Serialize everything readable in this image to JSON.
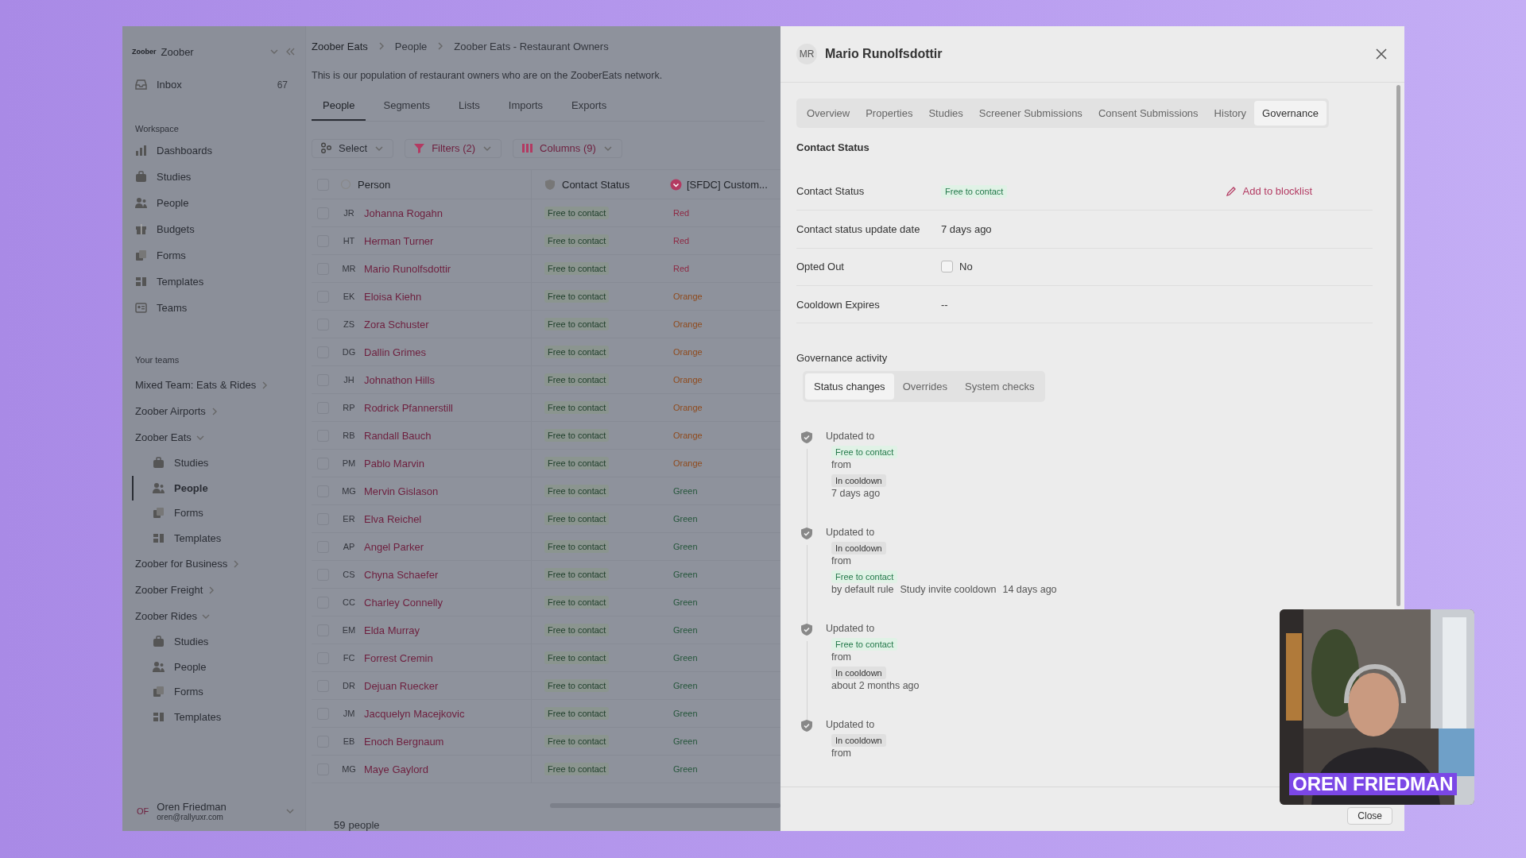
{
  "sidebar": {
    "workspace_name": "Zoober",
    "logo": "Zoober",
    "inbox": {
      "label": "Inbox",
      "count": "67"
    },
    "workspace_heading": "Workspace",
    "workspace_items": [
      {
        "label": "Dashboards"
      },
      {
        "label": "Studies"
      },
      {
        "label": "People"
      },
      {
        "label": "Budgets"
      },
      {
        "label": "Forms"
      },
      {
        "label": "Templates"
      },
      {
        "label": "Teams"
      }
    ],
    "teams_heading": "Your teams",
    "teams": [
      {
        "label": "Mixed Team: Eats & Rides",
        "expanded": false
      },
      {
        "label": "Zoober Airports",
        "expanded": false
      },
      {
        "label": "Zoober Eats",
        "expanded": true,
        "children": [
          {
            "label": "Studies",
            "selected": false
          },
          {
            "label": "People",
            "selected": true
          },
          {
            "label": "Forms",
            "selected": false
          },
          {
            "label": "Templates",
            "selected": false
          }
        ]
      },
      {
        "label": "Zoober for Business",
        "expanded": false
      },
      {
        "label": "Zoober Freight",
        "expanded": false
      },
      {
        "label": "Zoober Rides",
        "expanded": true,
        "children": [
          {
            "label": "Studies",
            "selected": false
          },
          {
            "label": "People",
            "selected": false
          },
          {
            "label": "Forms",
            "selected": false
          },
          {
            "label": "Templates",
            "selected": false
          }
        ]
      }
    ],
    "user": {
      "initials": "OF",
      "name": "Oren Friedman",
      "email": "oren@rallyuxr.com"
    }
  },
  "main": {
    "breadcrumb": [
      "Zoober Eats",
      "People",
      "Zoober Eats - Restaurant Owners"
    ],
    "description": "This is our population of restaurant owners who are on the ZooberEats network.",
    "tabs": [
      {
        "label": "People",
        "selected": true
      },
      {
        "label": "Segments",
        "selected": false
      },
      {
        "label": "Lists",
        "selected": false
      },
      {
        "label": "Imports",
        "selected": false
      },
      {
        "label": "Exports",
        "selected": false
      }
    ],
    "toolbar": [
      "Select",
      "Filters (2)",
      "Columns (9)"
    ],
    "table": {
      "columns": [
        "Person",
        "Contact Status",
        "[SFDC] Custom..."
      ],
      "all_checked": false,
      "rows": [
        {
          "checked": false,
          "initials": "JR",
          "name": "Johanna Rogahn",
          "status": "Free to contact",
          "sfdc": "Red",
          "color": "#8e2a44"
        },
        {
          "checked": false,
          "initials": "HT",
          "name": "Herman Turner",
          "status": "Free to contact",
          "sfdc": "Red",
          "color": "#8e2a44"
        },
        {
          "checked": false,
          "initials": "MR",
          "name": "Mario Runolfsdottir",
          "status": "Free to contact",
          "sfdc": "Red",
          "color": "#8e2a44"
        },
        {
          "checked": false,
          "initials": "EK",
          "name": "Eloisa Kiehn",
          "status": "Free to contact",
          "sfdc": "Orange",
          "color": "#8f4a1c"
        },
        {
          "checked": false,
          "initials": "ZS",
          "name": "Zora Schuster",
          "status": "Free to contact",
          "sfdc": "Orange",
          "color": "#8f4a1c"
        },
        {
          "checked": false,
          "initials": "DG",
          "name": "Dallin Grimes",
          "status": "Free to contact",
          "sfdc": "Orange",
          "color": "#8f4a1c"
        },
        {
          "checked": false,
          "initials": "JH",
          "name": "Johnathon Hills",
          "status": "Free to contact",
          "sfdc": "Orange",
          "color": "#8f4a1c"
        },
        {
          "checked": false,
          "initials": "RP",
          "name": "Rodrick Pfannerstill",
          "status": "Free to contact",
          "sfdc": "Orange",
          "color": "#8f4a1c"
        },
        {
          "checked": false,
          "initials": "RB",
          "name": "Randall Bauch",
          "status": "Free to contact",
          "sfdc": "Orange",
          "color": "#8f4a1c"
        },
        {
          "checked": false,
          "initials": "PM",
          "name": "Pablo Marvin",
          "status": "Free to contact",
          "sfdc": "Orange",
          "color": "#8f4a1c"
        },
        {
          "checked": false,
          "initials": "MG",
          "name": "Mervin Gislason",
          "status": "Free to contact",
          "sfdc": "Green",
          "color": "#24553a"
        },
        {
          "checked": false,
          "initials": "ER",
          "name": "Elva Reichel",
          "status": "Free to contact",
          "sfdc": "Green",
          "color": "#24553a"
        },
        {
          "checked": false,
          "initials": "AP",
          "name": "Angel Parker",
          "status": "Free to contact",
          "sfdc": "Green",
          "color": "#24553a"
        },
        {
          "checked": false,
          "initials": "CS",
          "name": "Chyna Schaefer",
          "status": "Free to contact",
          "sfdc": "Green",
          "color": "#24553a"
        },
        {
          "checked": false,
          "initials": "CC",
          "name": "Charley Connelly",
          "status": "Free to contact",
          "sfdc": "Green",
          "color": "#24553a"
        },
        {
          "checked": false,
          "initials": "EM",
          "name": "Elda Murray",
          "status": "Free to contact",
          "sfdc": "Green",
          "color": "#24553a"
        },
        {
          "checked": false,
          "initials": "FC",
          "name": "Forrest Cremin",
          "status": "Free to contact",
          "sfdc": "Green",
          "color": "#24553a"
        },
        {
          "checked": false,
          "initials": "DR",
          "name": "Dejuan Ruecker",
          "status": "Free to contact",
          "sfdc": "Green",
          "color": "#24553a"
        },
        {
          "checked": false,
          "initials": "JM",
          "name": "Jacquelyn Macejkovic",
          "status": "Free to contact",
          "sfdc": "Green",
          "color": "#24553a"
        },
        {
          "checked": false,
          "initials": "EB",
          "name": "Enoch Bergnaum",
          "status": "Free to contact",
          "sfdc": "Green",
          "color": "#24553a"
        },
        {
          "checked": false,
          "initials": "MG",
          "name": "Maye Gaylord",
          "status": "Free to contact",
          "sfdc": "Green",
          "color": "#24553a"
        }
      ],
      "count": "59",
      "count_label": "people"
    }
  },
  "drawer": {
    "initials": "MR",
    "title": "Mario Runolfsdottir",
    "tabs": [
      {
        "label": "Overview",
        "selected": false
      },
      {
        "label": "Properties",
        "selected": false
      },
      {
        "label": "Studies",
        "selected": false
      },
      {
        "label": "Screener Submissions",
        "selected": false
      },
      {
        "label": "Consent Submissions",
        "selected": false
      },
      {
        "label": "History",
        "selected": false
      },
      {
        "label": "Governance",
        "selected": true
      }
    ],
    "section_title": "Contact Status",
    "properties": [
      {
        "kind": "status",
        "label": "Contact Status",
        "value": "Free to contact",
        "action": "Add to blocklist"
      },
      {
        "kind": "text",
        "label": "Contact status update date",
        "value": "7 days ago"
      },
      {
        "kind": "checkbox",
        "label": "Opted Out",
        "checked": false,
        "value": "No"
      },
      {
        "kind": "text",
        "label": "Cooldown Expires",
        "value": "--"
      }
    ],
    "activity_title": "Governance activity",
    "activity_tabs": [
      {
        "label": "Status changes",
        "selected": true
      },
      {
        "label": "Overrides",
        "selected": false
      },
      {
        "label": "System checks",
        "selected": false
      }
    ],
    "events": [
      {
        "lines": [
          {
            "kind": "label",
            "text": "Updated to"
          },
          {
            "kind": "positive",
            "text": "Free to contact"
          },
          {
            "kind": "text",
            "text": "from"
          },
          {
            "kind": "neutral",
            "text": "In cooldown"
          },
          {
            "kind": "meta",
            "parts": [
              "7 days ago"
            ]
          }
        ]
      },
      {
        "lines": [
          {
            "kind": "label",
            "text": "Updated to"
          },
          {
            "kind": "neutral",
            "text": "In cooldown"
          },
          {
            "kind": "text",
            "text": "from"
          },
          {
            "kind": "positive",
            "text": "Free to contact"
          },
          {
            "kind": "meta",
            "parts": [
              "by default rule",
              "Study invite cooldown",
              "14 days ago"
            ]
          }
        ]
      },
      {
        "lines": [
          {
            "kind": "label",
            "text": "Updated to"
          },
          {
            "kind": "positive",
            "text": "Free to contact"
          },
          {
            "kind": "text",
            "text": "from"
          },
          {
            "kind": "neutral",
            "text": "In cooldown"
          },
          {
            "kind": "meta",
            "parts": [
              "about 2 months ago"
            ]
          }
        ]
      },
      {
        "lines": [
          {
            "kind": "label",
            "text": "Updated to"
          },
          {
            "kind": "neutral",
            "text": "In cooldown"
          },
          {
            "kind": "text",
            "text": "from"
          }
        ]
      }
    ],
    "close_button": "Close"
  },
  "video": {
    "kind": "picture",
    "caption": "OREN FRIEDMAN"
  }
}
